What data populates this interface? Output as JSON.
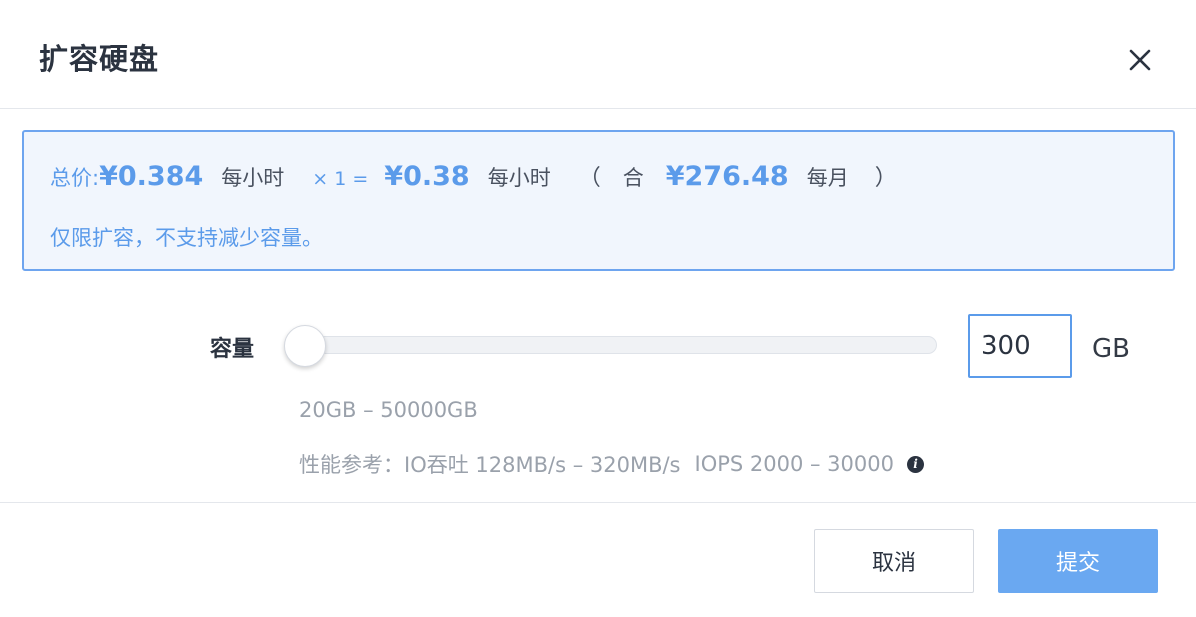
{
  "dialog": {
    "title": "扩容硬盘",
    "close_icon": "close-icon"
  },
  "price": {
    "total_label": "总价:",
    "total_amount": "¥0.384",
    "per_hour_1": "每小时",
    "multiplier": "× 1 =",
    "result_amount": "¥0.38",
    "per_hour_2": "每小时",
    "open_paren": "（",
    "equivalent_label": "合",
    "monthly_amount": "¥276.48",
    "per_month": "每月",
    "close_paren": "）",
    "note": "仅限扩容，不支持减少容量。"
  },
  "capacity": {
    "label": "容量",
    "value": "300",
    "unit": "GB",
    "slider_min": 20,
    "slider_max": 50000,
    "slider_value": 300,
    "range_text": "20GB – 50000GB",
    "perf_label": "性能参考：IO吞吐 128MB/s – 320MB/s",
    "perf_iops": "IOPS 2000 – 30000",
    "info_icon": "info-icon"
  },
  "footer": {
    "cancel_label": "取消",
    "submit_label": "提交"
  },
  "colors": {
    "accent": "#5b9bea",
    "accent_bg": "#f1f6fd",
    "submit_bg": "#6aa8f1",
    "text_dark": "#2b3340",
    "text_muted": "#9aa1ab",
    "divider": "#e4e7ec"
  }
}
